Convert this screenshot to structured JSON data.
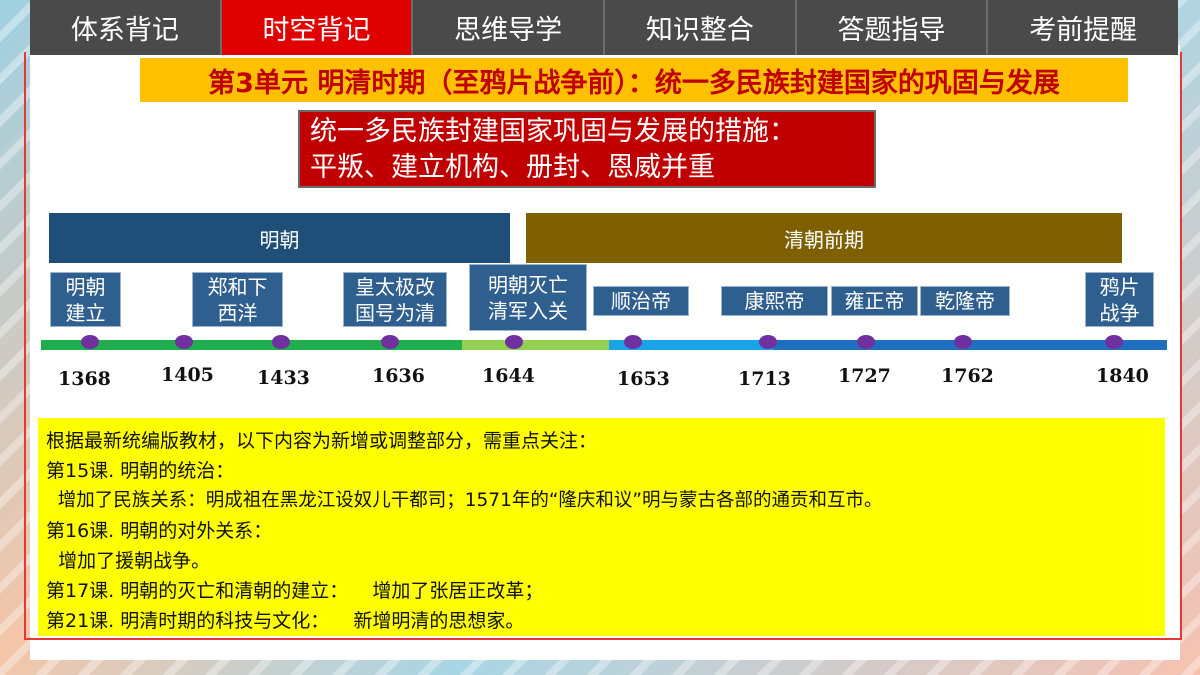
{
  "nav": {
    "tabs": [
      {
        "label": "体系背记"
      },
      {
        "label": "时空背记"
      },
      {
        "label": "思维导学"
      },
      {
        "label": "知识整合"
      },
      {
        "label": "答题指导"
      },
      {
        "label": "考前提醒"
      }
    ],
    "active_index": 1
  },
  "unit_title": "第3单元  明清时期（至鸦片战争前）：统一多民族封建国家的巩固与发展",
  "measures": {
    "line1": "统一多民族封建国家巩固与发展的措施：",
    "line2": "平叛、建立机构、册封、恩威并重"
  },
  "dynasties": {
    "ming": "明朝",
    "qing": "清朝前期"
  },
  "events": [
    {
      "line1": "明朝",
      "line2": "建立"
    },
    {
      "line1": "郑和下",
      "line2": "西洋"
    },
    {
      "line1": "皇太极改",
      "line2": "国号为清"
    },
    {
      "line1": "明朝灭亡",
      "line2": "清军入关"
    },
    {
      "line1": "顺治帝",
      "line2": ""
    },
    {
      "line1": "康熙帝",
      "line2": ""
    },
    {
      "line1": "雍正帝",
      "line2": ""
    },
    {
      "line1": "乾隆帝",
      "line2": ""
    },
    {
      "line1": "鸦片",
      "line2": "战争"
    }
  ],
  "years": [
    "1368",
    "1405",
    "1433",
    "1636",
    "1644",
    "1653",
    "1713",
    "1727",
    "1762",
    "1840"
  ],
  "colors": {
    "ming_segment": "#1fad4e",
    "transition_segment": "#92d050",
    "qing_light_segment": "#1aa3e8",
    "qing_segment": "#1f6fc0",
    "dot": "#7030a0"
  },
  "notes": [
    "根据最新统编版教材，以下内容为新增或调整部分，需重点关注：",
    "第15课. 明朝的统治：",
    "  增加了民族关系：明成祖在黑龙江设奴儿干都司；1571年的“隆庆和议”明与蒙古各部的通贡和互市。",
    "第16课. 明朝的对外关系：",
    "  增加了援朝战争。",
    "第17课. 明朝的灭亡和清朝的建立：    增加了张居正改革；",
    "第21课. 明清时期的科技与文化：    新增明清的思想家。"
  ]
}
